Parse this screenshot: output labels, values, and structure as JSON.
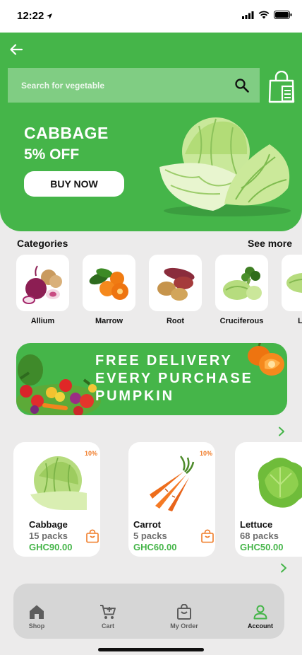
{
  "status_bar": {
    "time": "12:22"
  },
  "search": {
    "placeholder": "Search for vegetable"
  },
  "promo": {
    "title": "CABBAGE",
    "subtitle": "5% OFF",
    "cta_label": "BUY NOW"
  },
  "categories": {
    "title": "Categories",
    "see_more": "See more",
    "items": [
      {
        "label": "Allium"
      },
      {
        "label": "Marrow"
      },
      {
        "label": "Root"
      },
      {
        "label": "Cruciferous"
      },
      {
        "label": "Leafy"
      }
    ]
  },
  "delivery_banner": {
    "line1": "FREE DELIVERY",
    "line2": "EVERY PURCHASE",
    "line3": "PUMPKIN"
  },
  "products": [
    {
      "name": "Cabbage",
      "quantity": "15 packs",
      "price": "GHC90.00",
      "discount": "10%"
    },
    {
      "name": "Carrot",
      "quantity": "5 packs",
      "price": "GHC60.00",
      "discount": "10%"
    },
    {
      "name": "Lettuce",
      "quantity": "68 packs",
      "price": "GHC50.00",
      "discount": ""
    }
  ],
  "nav": {
    "items": [
      {
        "label": "Shop",
        "icon": "home-icon"
      },
      {
        "label": "Cart",
        "icon": "cart-icon"
      },
      {
        "label": "My Order",
        "icon": "shopping-bag-icon"
      },
      {
        "label": "Account",
        "icon": "user-icon"
      }
    ],
    "active": "Account"
  },
  "colors": {
    "brand_green": "#45b549",
    "accent_orange": "#f07b27",
    "background": "#ecebeb",
    "nav_bg": "#d6d6d6"
  }
}
